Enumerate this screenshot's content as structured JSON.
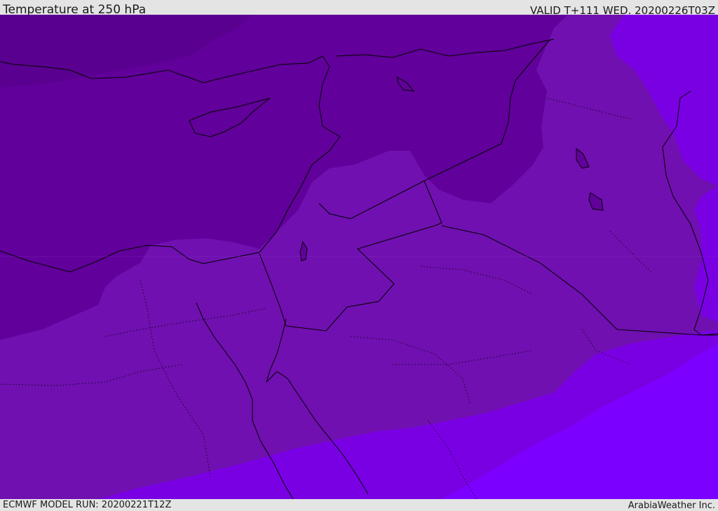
{
  "header": {
    "title": "Temperature at 250 hPa",
    "valid_time": "VALID T+111 WED. 20200226T03Z"
  },
  "footer": {
    "model_run": "ECMWF MODEL RUN: 20200221T12Z",
    "credit": "ArabiaWeather Inc."
  },
  "map": {
    "field": "temperature",
    "pressure_level": "250 hPa",
    "colors": {
      "coldest": "#61009a",
      "cold": "#7010b0",
      "mid": "#7a00e4",
      "warm": "#7c00ff",
      "coastline": "#000000",
      "border": "#000000"
    }
  }
}
